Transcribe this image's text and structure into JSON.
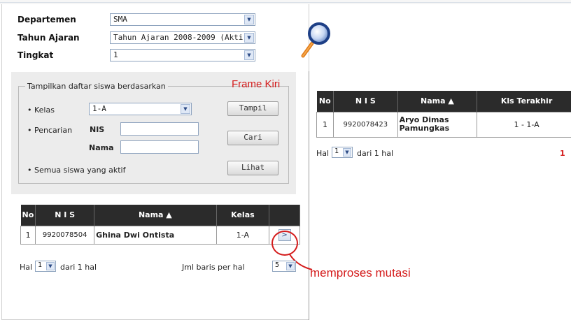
{
  "header": {
    "departemen": {
      "label": "Departemen",
      "value": "SMA"
    },
    "tahun_ajaran": {
      "label": "Tahun Ajaran",
      "value": "Tahun Ajaran 2008-2009 (Akti"
    },
    "tingkat": {
      "label": "Tingkat",
      "value": "1"
    }
  },
  "annotations": {
    "frame_kiri": "Frame Kiri",
    "memproses_mutasi": "memproses mutasi"
  },
  "filter": {
    "legend": "Tampilkan daftar siswa berdasarkan",
    "kelas_label": "• Kelas",
    "kelas_value": "1-A",
    "tampil_button": "Tampil",
    "pencarian_label": "• Pencarian",
    "nis_label": "NIS",
    "nama_label": "Nama",
    "cari_button": "Cari",
    "semua_label": "• Semua siswa yang aktif",
    "lihat_button": "Lihat"
  },
  "left_table": {
    "headers": [
      "No",
      "N I S",
      "Nama ▲",
      "Kelas",
      ""
    ],
    "rows": [
      {
        "no": "1",
        "nis": "9920078504",
        "nama": "Ghina Dwi Ontista",
        "kelas": "1-A",
        "action": ">"
      }
    ],
    "pager": {
      "hal_label": "Hal",
      "page": "1",
      "dari": "dari 1 hal",
      "per_page_label": "Jml baris per hal",
      "per_page": "5"
    }
  },
  "right_table": {
    "headers": [
      "No",
      "N I S",
      "Nama ▲",
      "Kls Terakhir"
    ],
    "rows": [
      {
        "no": "1",
        "nis": "9920078423",
        "nama": "Aryo Dimas Pamungkas",
        "kls": "1 - 1-A"
      }
    ],
    "pager": {
      "hal_label": "Hal",
      "page": "1",
      "dari": "dari 1 hal",
      "extra": "1"
    }
  },
  "icons": {
    "search": "magnifier-icon",
    "dropdown": "chevron-down-icon"
  },
  "colors": {
    "header_bg": "#2b2b2b",
    "annotation": "#d41b1b",
    "select_border": "#8fa4bf"
  }
}
